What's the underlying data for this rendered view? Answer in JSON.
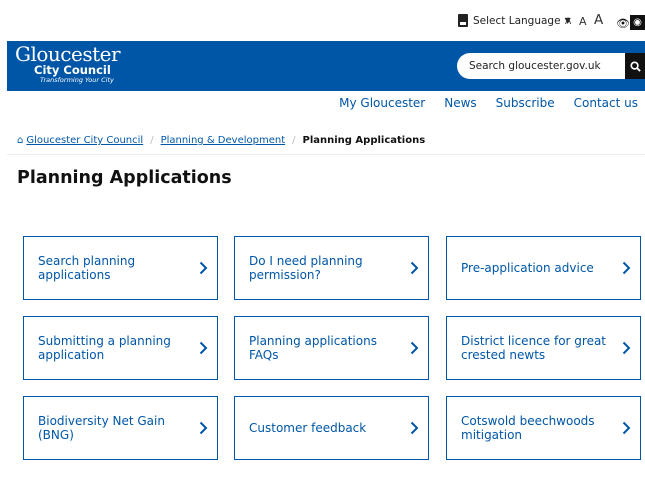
{
  "top_bar": {
    "language_label": "Select Language",
    "text_size": [
      "A",
      "A",
      "A"
    ],
    "icons": [
      "flag-icon",
      "eye-icon",
      "eye-filled-icon"
    ]
  },
  "header": {
    "logo": {
      "line1": "Gloucester",
      "line2": "City Council",
      "tagline": "Transforming Your City"
    },
    "search_placeholder": "Search gloucester.gov.uk",
    "brand_color": "#0056a6"
  },
  "util_nav": [
    "My Gloucester",
    "News",
    "Subscribe",
    "Contact us"
  ],
  "breadcrumb": {
    "items": [
      "Gloucester City Council",
      "Planning & Development"
    ],
    "current": "Planning Applications"
  },
  "page_title": "Planning Applications",
  "cards": [
    "Search planning applications",
    "Do I need planning permission?",
    "Pre-application advice",
    "Submitting a planning application",
    "Planning applications FAQs",
    "District licence for great crested newts",
    "Biodiversity Net Gain (BNG)",
    "Customer feedback",
    "Cotswold beechwoods mitigation"
  ]
}
